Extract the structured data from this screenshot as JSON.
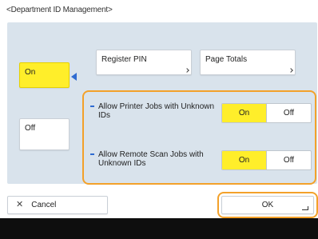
{
  "screen": {
    "title": "<Department ID Management>"
  },
  "mode": {
    "on_label": "On",
    "off_label": "Off",
    "selected": "On"
  },
  "actions": {
    "register_pin": "Register PIN",
    "page_totals": "Page Totals"
  },
  "options": [
    {
      "label": "Allow Printer Jobs with Unknown IDs",
      "on": "On",
      "off": "Off",
      "selected": "On"
    },
    {
      "label": "Allow Remote Scan Jobs with Unknown IDs",
      "on": "On",
      "off": "Off",
      "selected": "On"
    }
  ],
  "footer": {
    "cancel_label": "Cancel",
    "ok_label": "OK"
  },
  "colors": {
    "selected": "#ffee2a",
    "highlight": "#f3a12a",
    "panel": "#d9e3ec",
    "accent": "#2f6bd1"
  },
  "icons": {
    "cancel": "close-icon",
    "ok": "enter-icon"
  }
}
